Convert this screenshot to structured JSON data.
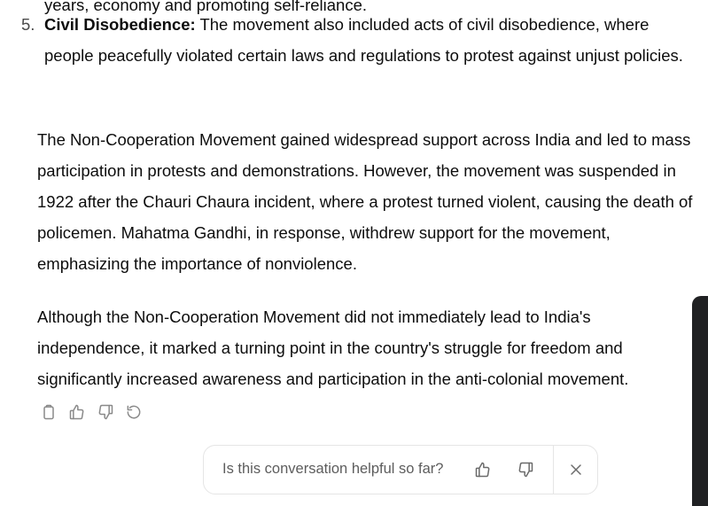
{
  "cutoff_text": "years, economy and promoting self-reliance.",
  "list_item": {
    "number": "5.",
    "title": "Civil Disobedience:",
    "text": " The movement also included acts of civil disobedience, where people peacefully violated certain laws and regulations to protest against unjust policies."
  },
  "paragraphs": [
    "The Non-Cooperation Movement gained widespread support across India and led to mass participation in protests and demonstrations. However, the movement was suspended in 1922 after the Chauri Chaura incident, where a protest turned violent, causing the death of policemen. Mahatma Gandhi, in response, withdrew support for the movement, emphasizing the importance of nonviolence.",
    "Although the Non-Cooperation Movement did not immediately lead to India's independence, it marked a turning point in the country's struggle for freedom and significantly increased awareness and participation in the anti-colonial movement."
  ],
  "actions": {
    "copy_icon": "clipboard-icon",
    "like_icon": "thumbs-up-icon",
    "dislike_icon": "thumbs-down-icon",
    "regenerate_icon": "regenerate-icon"
  },
  "feedback": {
    "question": "Is this conversation helpful so far?",
    "up_icon": "thumbs-up-icon",
    "down_icon": "thumbs-down-icon",
    "close_icon": "close-icon"
  },
  "colors": {
    "text": "#0d0d0d",
    "muted_icon": "#8a8a8a",
    "border": "#e5e5e5",
    "dark_panel": "#202123"
  }
}
